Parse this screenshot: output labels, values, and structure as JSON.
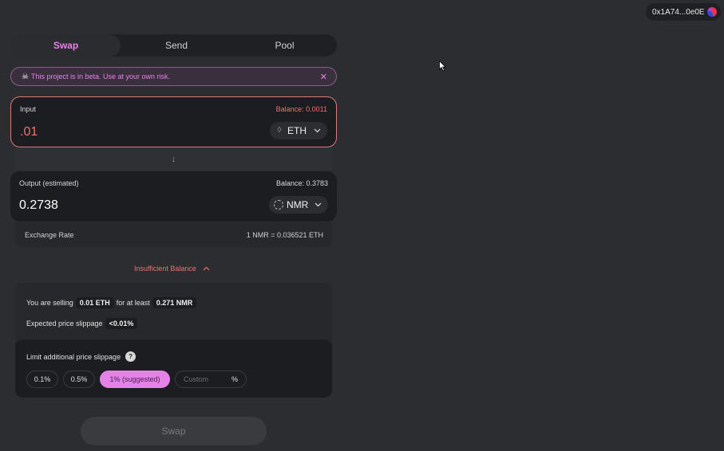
{
  "wallet": {
    "address": "0x1A74...0e0E"
  },
  "tabs": [
    {
      "label": "Swap",
      "active": true
    },
    {
      "label": "Send",
      "active": false
    },
    {
      "label": "Pool",
      "active": false
    }
  ],
  "banner": {
    "icon": "skull-icon",
    "text": "This project is in beta. Use at your own risk.",
    "close": "✕"
  },
  "input": {
    "label": "Input",
    "balance": "Balance: 0.0011",
    "amount": ".01",
    "token": "ETH"
  },
  "arrow": "↓",
  "output": {
    "label": "Output (estimated)",
    "balance": "Balance: 0.3783",
    "amount": "0.2738",
    "token": "NMR"
  },
  "rate": {
    "label": "Exchange Rate",
    "value": "1 NMR = 0.036521 ETH"
  },
  "warning": {
    "text": "Insufficient Balance",
    "icon": "chevron-up-icon"
  },
  "summary": {
    "selling_prefix": "You are selling",
    "selling_amount": "0.01 ETH",
    "for_text": "for at least",
    "receive_amount": "0.271 NMR",
    "slippage_label": "Expected price slippage",
    "slippage_value": "<0.01%"
  },
  "limit": {
    "title": "Limit additional price slippage",
    "help": "?",
    "options": [
      "0.1%",
      "0.5%",
      "1% (suggested)"
    ],
    "custom_placeholder": "Custom",
    "custom_suffix": "%"
  },
  "swap_button": "Swap",
  "colors": {
    "accent": "#e482e8",
    "error": "#f07070",
    "background": "#2c2d30",
    "card": "#1c1d20"
  }
}
